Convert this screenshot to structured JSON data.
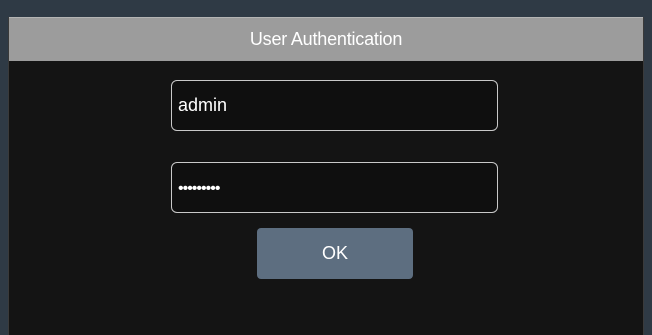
{
  "dialog": {
    "title": "User Authentication",
    "username_value": "admin",
    "password_value": "•••••••••",
    "ok_label": "OK"
  },
  "colors": {
    "titlebar": "#9c9c9c",
    "dialog_bg": "#141414",
    "button_bg": "#5d6e80",
    "frame_bg": "#2f3a45"
  }
}
